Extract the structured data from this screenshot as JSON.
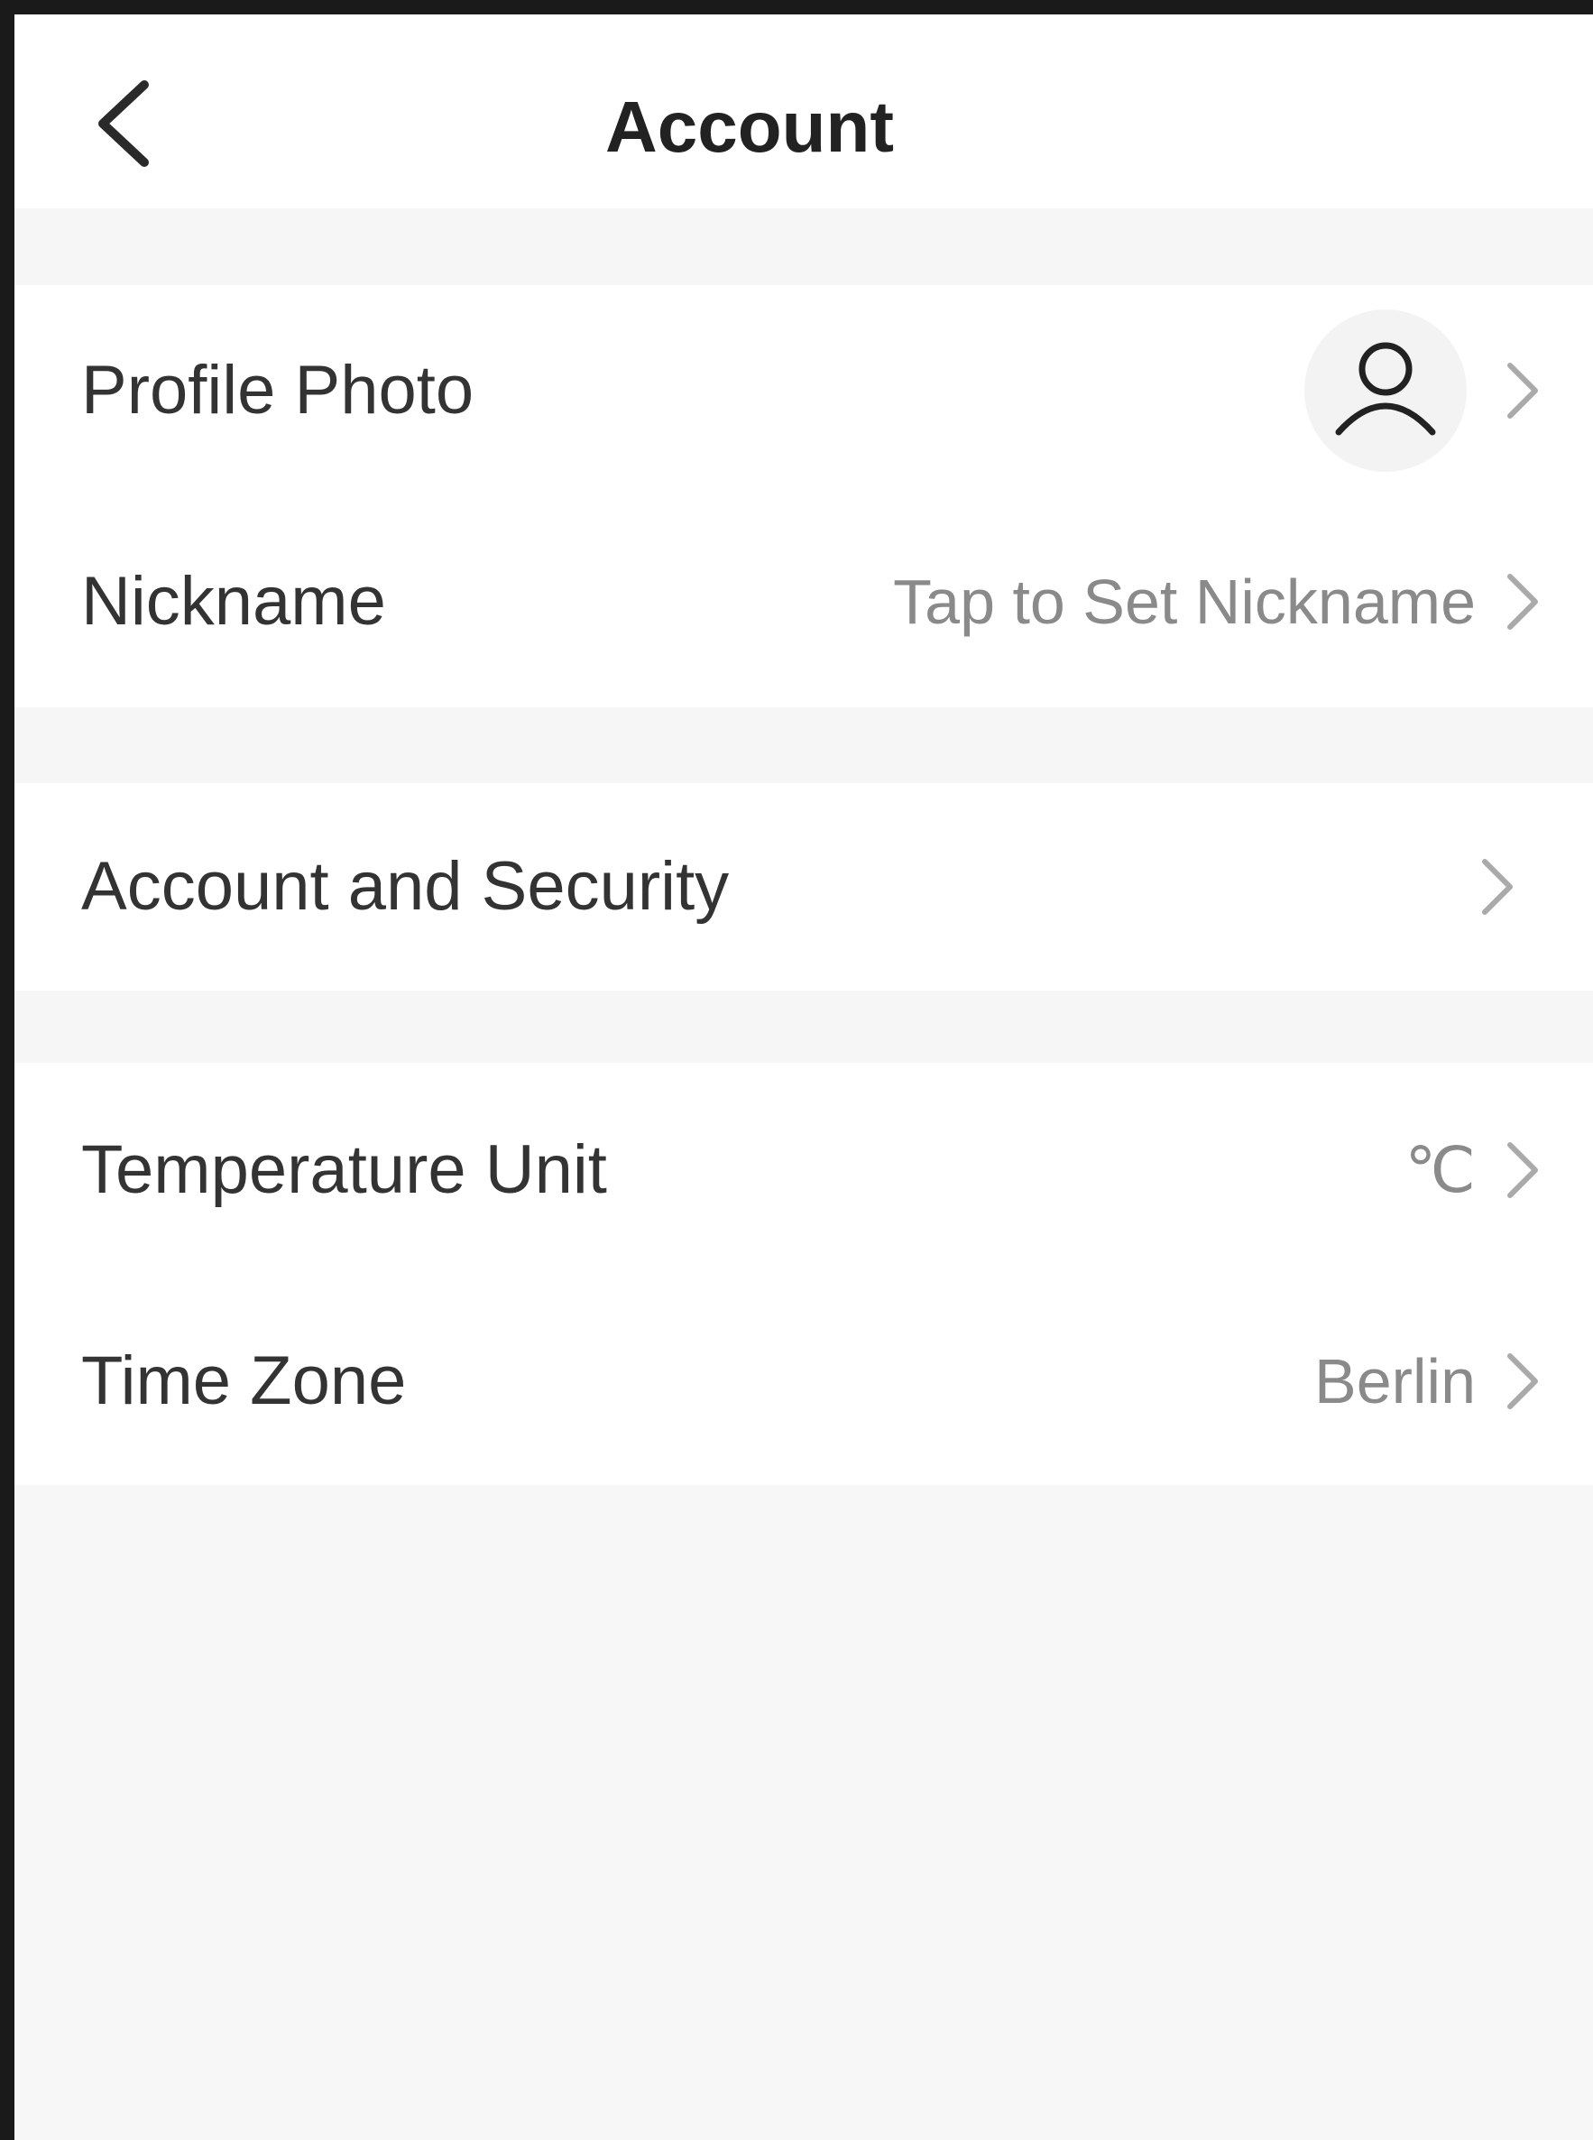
{
  "header": {
    "title": "Account",
    "back_icon": "chevron-left-icon"
  },
  "profile_group": {
    "profile_photo": {
      "label": "Profile Photo",
      "avatar_icon": "user-avatar-icon"
    },
    "nickname": {
      "label": "Nickname",
      "value": "Tap to Set Nickname"
    }
  },
  "security_group": {
    "account_security": {
      "label": "Account and Security"
    }
  },
  "settings_group": {
    "temperature_unit": {
      "label": "Temperature Unit",
      "value": "℃"
    },
    "time_zone": {
      "label": "Time Zone",
      "value": "Berlin"
    }
  },
  "colors": {
    "background": "#f7f7f7",
    "card": "#ffffff",
    "text_primary": "#333333",
    "text_secondary": "#8a8a8a",
    "chevron": "#aaaaaa"
  }
}
